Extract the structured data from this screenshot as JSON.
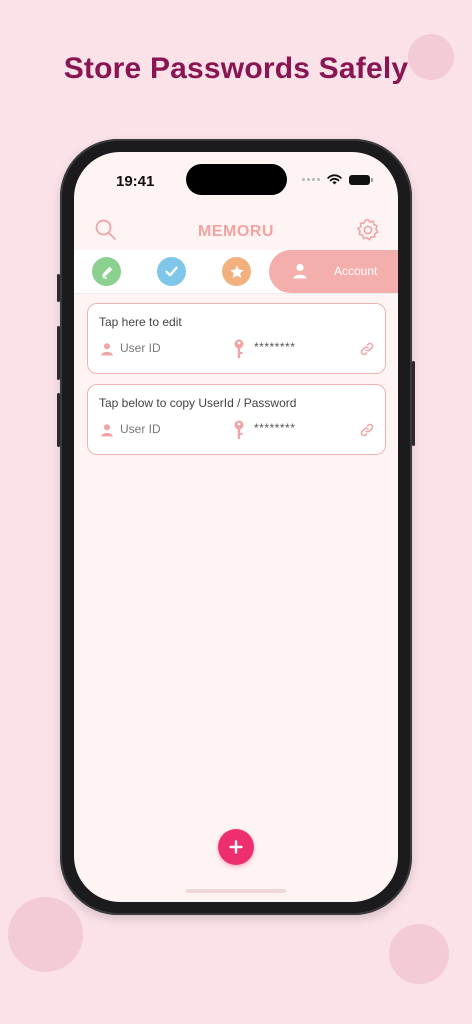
{
  "headline": "Store Passwords Safely",
  "status_bar": {
    "time": "19:41"
  },
  "header": {
    "title": "MEMORU",
    "search_icon": "search-icon",
    "settings_icon": "gear-icon"
  },
  "tabs": [
    {
      "icon": "pen-icon",
      "color": "#8bd08e"
    },
    {
      "icon": "check-icon",
      "color": "#7ec6ea"
    },
    {
      "icon": "star-icon",
      "color": "#f1b07e"
    },
    {
      "icon": "person-icon",
      "label": "Account",
      "color": "#f4afac",
      "active": true
    }
  ],
  "cards": [
    {
      "title": "Tap here to edit",
      "user_label": "User ID",
      "password_mask": "********"
    },
    {
      "title": "Tap below to copy UserId / Password",
      "user_label": "User ID",
      "password_mask": "********"
    }
  ],
  "fab": {
    "icon": "plus-icon",
    "color": "#ee2f6f"
  },
  "colors": {
    "background": "#fbe2e9",
    "headline": "#8a1553",
    "accent": "#f4afac",
    "screen_bg": "#fff4f4"
  }
}
